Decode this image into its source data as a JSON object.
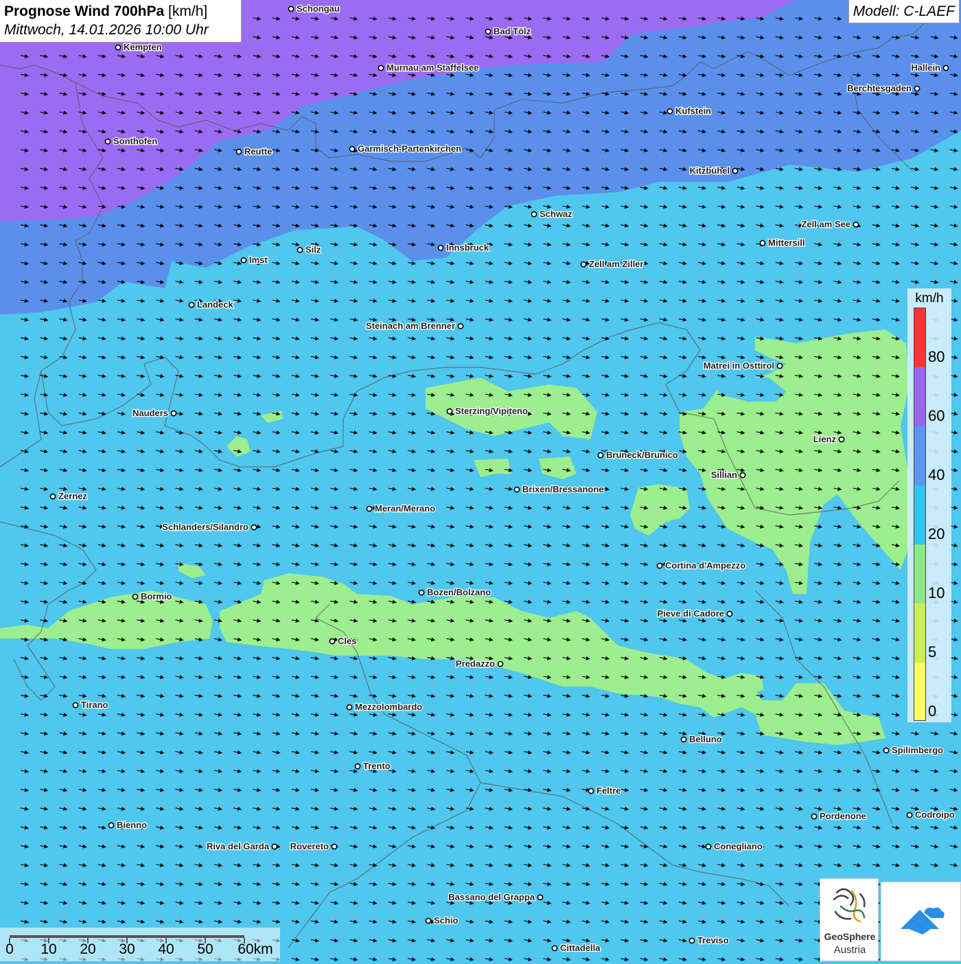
{
  "header": {
    "title_bold": "Prognose Wind 700hPa",
    "title_unit": "[km/h]",
    "datetime": "Mittwoch, 14.01.2026 10:00 Uhr",
    "model": "Modell: C-LAEF"
  },
  "colors": {
    "band_0": "#ffff66",
    "band_5": "#ccee55",
    "band_10": "#8ee888",
    "band_20": "#33c4f0",
    "band_40": "#5a96ee",
    "band_60": "#9966ee",
    "band_80": "#ff3333",
    "field_low": "#9cee8e",
    "field_mid": "#4fc7ee",
    "field_high": "#5a90ec",
    "field_top": "#9b6cf2"
  },
  "legend": {
    "unit": "km/h",
    "labels": [
      "80",
      "60",
      "40",
      "20",
      "10",
      "5",
      "0"
    ]
  },
  "cities": [
    {
      "name": "Schongau",
      "label_side": "right"
    },
    {
      "name": "Bad Tölz",
      "label_side": "right"
    },
    {
      "name": "Kempten",
      "label_side": "right"
    },
    {
      "name": "Murnau am Staffelsee",
      "label_side": "right"
    },
    {
      "name": "Hallein",
      "label_side": "left"
    },
    {
      "name": "Berchtesgaden",
      "label_side": "left"
    },
    {
      "name": "Kufstein",
      "label_side": "right"
    },
    {
      "name": "Sonthofen",
      "label_side": "right"
    },
    {
      "name": "Reutte",
      "label_side": "right"
    },
    {
      "name": "Garmisch-Partenkirchen",
      "label_side": "right"
    },
    {
      "name": "Kitzbühel",
      "label_side": "left"
    },
    {
      "name": "Schwaz",
      "label_side": "right"
    },
    {
      "name": "Zell am See",
      "label_side": "left"
    },
    {
      "name": "Innsbruck",
      "label_side": "right"
    },
    {
      "name": "Mittersill",
      "label_side": "right"
    },
    {
      "name": "Silz",
      "label_side": "right"
    },
    {
      "name": "Imst",
      "label_side": "right"
    },
    {
      "name": "Zell am Ziller",
      "label_side": "right"
    },
    {
      "name": "Landeck",
      "label_side": "right"
    },
    {
      "name": "Steinach am Brenner",
      "label_side": "left"
    },
    {
      "name": "Matrei in Osttirol",
      "label_side": "left"
    },
    {
      "name": "Nauders",
      "label_side": "left"
    },
    {
      "name": "Sterzing/Vipiteno",
      "label_side": "right"
    },
    {
      "name": "Lienz",
      "label_side": "left"
    },
    {
      "name": "Bruneck/Brunico",
      "label_side": "right"
    },
    {
      "name": "Sillian",
      "label_side": "left"
    },
    {
      "name": "Brixen/Bressanone",
      "label_side": "right"
    },
    {
      "name": "Zernez",
      "label_side": "right"
    },
    {
      "name": "Meran/Merano",
      "label_side": "right"
    },
    {
      "name": "Schlanders/Silandro",
      "label_side": "left"
    },
    {
      "name": "Cortina d'Ampezzo",
      "label_side": "right"
    },
    {
      "name": "Bormio",
      "label_side": "right"
    },
    {
      "name": "Bozen/Bolzano",
      "label_side": "right"
    },
    {
      "name": "Pieve di Cadore",
      "label_side": "left"
    },
    {
      "name": "Cles",
      "label_side": "right"
    },
    {
      "name": "Predazzo",
      "label_side": "left"
    },
    {
      "name": "Tirano",
      "label_side": "right"
    },
    {
      "name": "Mezzolombardo",
      "label_side": "right"
    },
    {
      "name": "Belluno",
      "label_side": "right"
    },
    {
      "name": "Spilimbergo",
      "label_side": "right"
    },
    {
      "name": "Trento",
      "label_side": "right"
    },
    {
      "name": "Feltre",
      "label_side": "right"
    },
    {
      "name": "Pordenone",
      "label_side": "right"
    },
    {
      "name": "Codroipo",
      "label_side": "right"
    },
    {
      "name": "Bienno",
      "label_side": "right"
    },
    {
      "name": "Riva del Garda",
      "label_side": "left"
    },
    {
      "name": "Rovereto",
      "label_side": "left"
    },
    {
      "name": "Conegliano",
      "label_side": "right"
    },
    {
      "name": "Bassano del Grappa",
      "label_side": "left"
    },
    {
      "name": "Schio",
      "label_side": "right"
    },
    {
      "name": "Treviso",
      "label_side": "right"
    },
    {
      "name": "Cittadella",
      "label_side": "right"
    }
  ],
  "scale_bar": {
    "labels": [
      "0",
      "10",
      "20",
      "30",
      "40",
      "50",
      "60km"
    ]
  },
  "logo": {
    "name": "GeoSphere",
    "sub": "Austria"
  }
}
